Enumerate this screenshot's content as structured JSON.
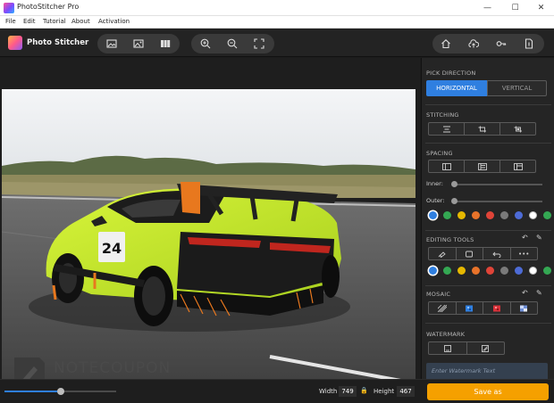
{
  "window": {
    "title": "PhotoStitcher Pro",
    "minimize": "—",
    "maximize": "☐",
    "close": "✕"
  },
  "menu": [
    {
      "label": "File"
    },
    {
      "label": "Edit"
    },
    {
      "label": "Tutorial"
    },
    {
      "label": "About"
    },
    {
      "label": "Activation"
    }
  ],
  "toolbar": {
    "app_name": "Photo Stitcher",
    "left_group": [
      "add-image-icon",
      "add-image-alt-icon",
      "columns-icon"
    ],
    "zoom_group": [
      "zoom-in-icon",
      "zoom-out-icon",
      "fit-screen-icon"
    ],
    "right_group": [
      "home-icon",
      "upload-icon",
      "key-icon",
      "document-icon"
    ]
  },
  "panel": {
    "pick_direction": {
      "label": "PICK DIRECTION",
      "horizontal": "HORIZONTAL",
      "vertical": "VERTICAL",
      "selected": "HORIZONTAL"
    },
    "stitching": {
      "label": "STITCHING"
    },
    "spacing": {
      "label": "SPACING",
      "inner_label": "Inner:",
      "outer_label": "Outer:"
    },
    "editing_tools": {
      "label": "EDITING TOOLS",
      "more": "•••"
    },
    "mosaic": {
      "label": "MOSAIC"
    },
    "watermark": {
      "label": "WATERMARK",
      "placeholder": "Enter Watermark Text"
    },
    "colors": [
      "#2f7fe0",
      "#34a853",
      "#e6b800",
      "#e8732a",
      "#e04438",
      "#7a7a7a",
      "#4d6bd6",
      "#ffffff",
      "#34a853"
    ]
  },
  "bottom": {
    "zoom_level": 0.5,
    "width_label": "Width",
    "width_value": "749",
    "height_label": "Height",
    "height_value": "467",
    "save_label": "Save as"
  },
  "overlay": {
    "watermark_text": "NOTECOUPON"
  }
}
